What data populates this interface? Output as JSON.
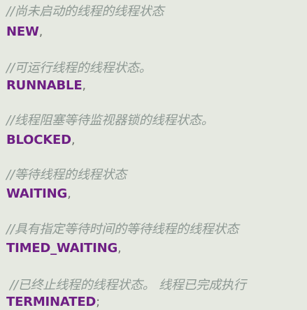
{
  "theme": {
    "background": "#e6e9e1",
    "comment_color": "#8d9893",
    "enum_constant_color": "#6e1f84",
    "punctuation_color": "#6f736c"
  },
  "code_block": {
    "entries": [
      {
        "comment": "//尚未启动的线程的线程状态",
        "constant": "NEW",
        "punct": ","
      },
      {
        "comment": "//可运行线程的线程状态。",
        "constant": "RUNNABLE",
        "punct": ","
      },
      {
        "comment": "//线程阻塞等待监视器锁的线程状态。",
        "constant": "BLOCKED",
        "punct": ","
      },
      {
        "comment": "//等待线程的线程状态",
        "constant": "WAITING",
        "punct": ","
      },
      {
        "comment": "//具有指定等待时间的等待线程的线程状态",
        "constant": "TIMED_WAITING",
        "punct": ","
      },
      {
        "comment": "//已终止线程的线程状态。 线程已完成执行",
        "constant": "TERMINATED",
        "punct": ";"
      }
    ]
  }
}
